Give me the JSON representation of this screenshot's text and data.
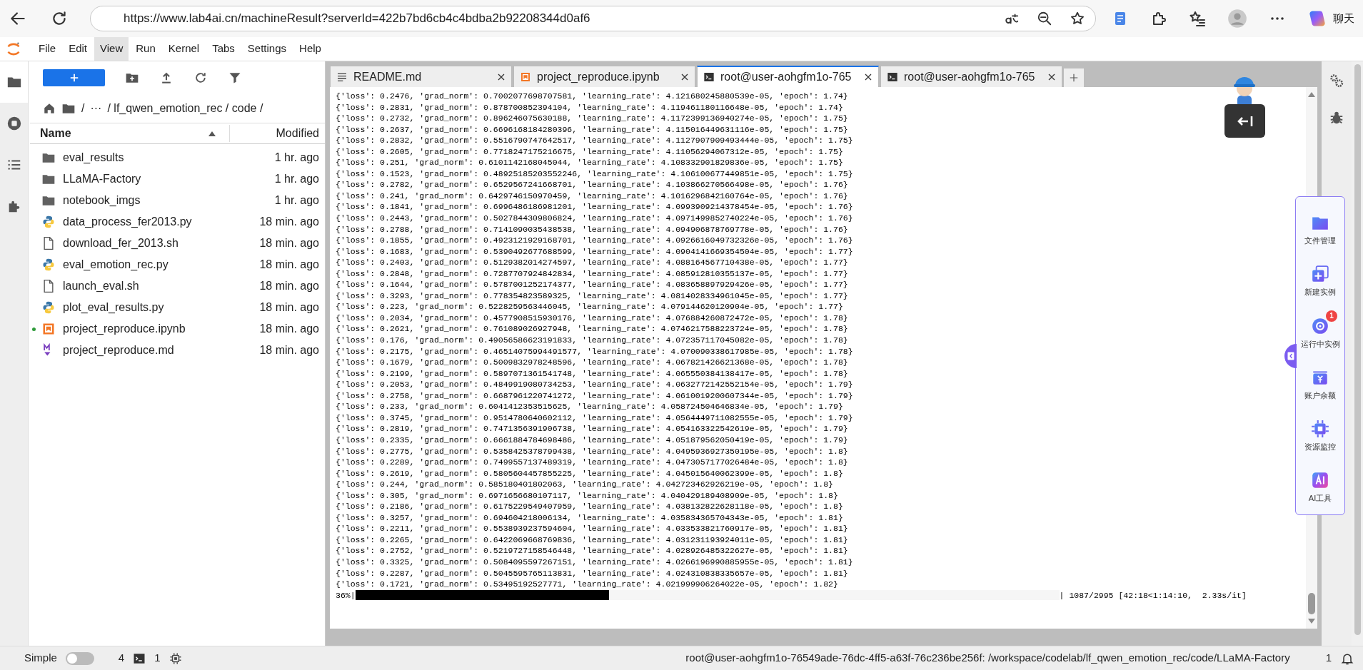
{
  "browser": {
    "url": "https://www.lab4ai.cn/machineResult?serverId=422b7bd6cb4c4bdba2b92208344d0af6",
    "chat_label": "聊天"
  },
  "menu": [
    {
      "label": "File",
      "selected": false
    },
    {
      "label": "Edit",
      "selected": false
    },
    {
      "label": "View",
      "selected": true
    },
    {
      "label": "Run",
      "selected": false
    },
    {
      "label": "Kernel",
      "selected": false
    },
    {
      "label": "Tabs",
      "selected": false
    },
    {
      "label": "Settings",
      "selected": false
    },
    {
      "label": "Help",
      "selected": false
    }
  ],
  "left_rail": [
    {
      "kind": "folder",
      "selected": true
    },
    {
      "kind": "running",
      "selected": false
    },
    {
      "kind": "toc",
      "selected": false
    },
    {
      "kind": "extensions",
      "selected": false
    }
  ],
  "file_browser": {
    "breadcrumb": [
      "/",
      "···",
      "/ lf_qwen_emotion_rec / code /"
    ],
    "columns": [
      "Name",
      "Modified"
    ],
    "files": [
      {
        "name": "eval_results",
        "modified": "1 hr. ago",
        "kind": "folder",
        "open": false
      },
      {
        "name": "LLaMA-Factory",
        "modified": "1 hr. ago",
        "kind": "folder",
        "open": false
      },
      {
        "name": "notebook_imgs",
        "modified": "1 hr. ago",
        "kind": "folder",
        "open": false
      },
      {
        "name": "data_process_fer2013.py",
        "modified": "18 min. ago",
        "kind": "python",
        "open": false
      },
      {
        "name": "download_fer_2013.sh",
        "modified": "18 min. ago",
        "kind": "file",
        "open": false
      },
      {
        "name": "eval_emotion_rec.py",
        "modified": "18 min. ago",
        "kind": "python",
        "open": false
      },
      {
        "name": "launch_eval.sh",
        "modified": "18 min. ago",
        "kind": "file",
        "open": false
      },
      {
        "name": "plot_eval_results.py",
        "modified": "18 min. ago",
        "kind": "python",
        "open": false
      },
      {
        "name": "project_reproduce.ipynb",
        "modified": "18 min. ago",
        "kind": "notebook",
        "open": true
      },
      {
        "name": "project_reproduce.md",
        "modified": "18 min. ago",
        "kind": "markdown",
        "open": false
      }
    ]
  },
  "tabs": [
    {
      "label": "README.md",
      "kind": "text",
      "selected": false
    },
    {
      "label": "project_reproduce.ipynb",
      "kind": "notebook",
      "selected": false
    },
    {
      "label": "root@user-aohgfm1o-765",
      "kind": "terminal",
      "selected": true
    },
    {
      "label": "root@user-aohgfm1o-765",
      "kind": "terminal",
      "selected": false
    }
  ],
  "terminal": {
    "lines": [
      "{'loss': 0.2476, 'grad_norm': 0.7002077698707581, 'learning_rate': 4.121680245880539e-05, 'epoch': 1.74}",
      "{'loss': 0.2831, 'grad_norm': 0.878700852394104, 'learning_rate': 4.119461180116648e-05, 'epoch': 1.74}",
      "{'loss': 0.2732, 'grad_norm': 0.896246075630188, 'learning_rate': 4.1172399136940274e-05, 'epoch': 1.75}",
      "{'loss': 0.2637, 'grad_norm': 0.6696168184280396, 'learning_rate': 4.115016449631116e-05, 'epoch': 1.75}",
      "{'loss': 0.2832, 'grad_norm': 0.5516790747642517, 'learning_rate': 4.1127907909493444e-05, 'epoch': 1.75}",
      "{'loss': 0.2605, 'grad_norm': 0.7718247175216675, 'learning_rate': 4.11056294067312e-05, 'epoch': 1.75}",
      "{'loss': 0.251, 'grad_norm': 0.6101142168045044, 'learning_rate': 4.108332901829836e-05, 'epoch': 1.75}",
      "{'loss': 0.1523, 'grad_norm': 0.48925185203552246, 'learning_rate': 4.106100677449851e-05, 'epoch': 1.75}",
      "{'loss': 0.2782, 'grad_norm': 0.6529567241668701, 'learning_rate': 4.103866270566498e-05, 'epoch': 1.76}",
      "{'loss': 0.241, 'grad_norm': 0.6429746150970459, 'learning_rate': 4.1016296842160764e-05, 'epoch': 1.76}",
      "{'loss': 0.1841, 'grad_norm': 0.6996486186981201, 'learning_rate': 4.0993909214378454e-05, 'epoch': 1.76}",
      "{'loss': 0.2443, 'grad_norm': 0.5027844309806824, 'learning_rate': 4.0971499852740224e-05, 'epoch': 1.76}",
      "{'loss': 0.2788, 'grad_norm': 0.7141090035438538, 'learning_rate': 4.094906878769778e-05, 'epoch': 1.76}",
      "{'loss': 0.1855, 'grad_norm': 0.4923121929168701, 'learning_rate': 4.0926616049732326e-05, 'epoch': 1.76}",
      "{'loss': 0.1683, 'grad_norm': 0.5390492677688599, 'learning_rate': 4.0904141669354504e-05, 'epoch': 1.77}",
      "{'loss': 0.2403, 'grad_norm': 0.5129382014274597, 'learning_rate': 4.088164567710438e-05, 'epoch': 1.77}",
      "{'loss': 0.2848, 'grad_norm': 0.7287707924842834, 'learning_rate': 4.085912810355137e-05, 'epoch': 1.77}",
      "{'loss': 0.1644, 'grad_norm': 0.5787001252174377, 'learning_rate': 4.083658897929426e-05, 'epoch': 1.77}",
      "{'loss': 0.3293, 'grad_norm': 0.778354823589325, 'learning_rate': 4.0814028334961045e-05, 'epoch': 1.77}",
      "{'loss': 0.223, 'grad_norm': 0.5228259563446045, 'learning_rate': 4.079144620120904e-05, 'epoch': 1.77}",
      "{'loss': 0.2034, 'grad_norm': 0.4577908515930176, 'learning_rate': 4.076884260872472e-05, 'epoch': 1.78}",
      "{'loss': 0.2621, 'grad_norm': 0.761089026927948, 'learning_rate': 4.0746217588223724e-05, 'epoch': 1.78}",
      "{'loss': 0.176, 'grad_norm': 0.49056586623191833, 'learning_rate': 4.072357117045082e-05, 'epoch': 1.78}",
      "{'loss': 0.2175, 'grad_norm': 0.46514075994491577, 'learning_rate': 4.070090338617985e-05, 'epoch': 1.78}",
      "{'loss': 0.1679, 'grad_norm': 0.5009832978248596, 'learning_rate': 4.067821426621368e-05, 'epoch': 1.78}",
      "{'loss': 0.2199, 'grad_norm': 0.5897071361541748, 'learning_rate': 4.065550384138417e-05, 'epoch': 1.78}",
      "{'loss': 0.2053, 'grad_norm': 0.4849919080734253, 'learning_rate': 4.0632772142552154e-05, 'epoch': 1.79}",
      "{'loss': 0.2758, 'grad_norm': 0.6687961220741272, 'learning_rate': 4.0610019200607344e-05, 'epoch': 1.79}",
      "{'loss': 0.233, 'grad_norm': 0.6041412353515625, 'learning_rate': 4.058724504646834e-05, 'epoch': 1.79}",
      "{'loss': 0.3745, 'grad_norm': 0.9514780640602112, 'learning_rate': 4.0564449711082555e-05, 'epoch': 1.79}",
      "{'loss': 0.2819, 'grad_norm': 0.7471356391906738, 'learning_rate': 4.054163322542619e-05, 'epoch': 1.79}",
      "{'loss': 0.2335, 'grad_norm': 0.6661884784698486, 'learning_rate': 4.051879562050419e-05, 'epoch': 1.79}",
      "{'loss': 0.2775, 'grad_norm': 0.5358425378799438, 'learning_rate': 4.0495936927350195e-05, 'epoch': 1.8}",
      "{'loss': 0.2289, 'grad_norm': 0.7499557137489319, 'learning_rate': 4.0473057177026484e-05, 'epoch': 1.8}",
      "{'loss': 0.2619, 'grad_norm': 0.5805604457855225, 'learning_rate': 4.045015640062399e-05, 'epoch': 1.8}",
      "{'loss': 0.244, 'grad_norm': 0.585180401802063, 'learning_rate': 4.042723462926219e-05, 'epoch': 1.8}",
      "{'loss': 0.305, 'grad_norm': 0.6971656680107117, 'learning_rate': 4.040429189408909e-05, 'epoch': 1.8}",
      "{'loss': 0.2186, 'grad_norm': 0.6175229549407959, 'learning_rate': 4.038132822628118e-05, 'epoch': 1.8}",
      "{'loss': 0.3257, 'grad_norm': 0.694604218006134, 'learning_rate': 4.035834365704343e-05, 'epoch': 1.81}",
      "{'loss': 0.2211, 'grad_norm': 0.5538939237594604, 'learning_rate': 4.033533821760917e-05, 'epoch': 1.81}",
      "{'loss': 0.2265, 'grad_norm': 0.6422069668769836, 'learning_rate': 4.031231193924011e-05, 'epoch': 1.81}",
      "{'loss': 0.2752, 'grad_norm': 0.5219727158546448, 'learning_rate': 4.028926485322627e-05, 'epoch': 1.81}",
      "{'loss': 0.3325, 'grad_norm': 0.5084095597267151, 'learning_rate': 4.0266196990885955e-05, 'epoch': 1.81}",
      "{'loss': 0.2287, 'grad_norm': 0.5045595765113831, 'learning_rate': 4.024310838335657e-05, 'epoch': 1.81}",
      "{'loss': 0.1721, 'grad_norm': 0.53495192527771, 'learning_rate': 4.021999906264022e-05, 'epoch': 1.82}"
    ],
    "progress": {
      "percent": "36%|",
      "level": 0.36,
      "stats": "| 1087/2995 [42:18<1:14:10,  2.33s/it]"
    }
  },
  "right_rail": [
    {
      "kind": "property-inspector"
    },
    {
      "kind": "debugger"
    }
  ],
  "side_panel": [
    {
      "label": "文件管理",
      "kind": "folder"
    },
    {
      "label": "新建实例",
      "kind": "new"
    },
    {
      "label": "运行中实例",
      "kind": "running",
      "badge": "1"
    },
    {
      "label": "账户余额",
      "kind": "wallet"
    },
    {
      "label": "资源监控",
      "kind": "chip"
    },
    {
      "label": "AI工具",
      "kind": "ai"
    }
  ],
  "status_bar": {
    "mode_label": "Simple",
    "simple_mode": false,
    "kernels": "4",
    "terminals": "1",
    "path": "root@user-aohgfm1o-76549ade-76dc-4ff5-a63f-76c236be256f: /workspace/codelab/lf_qwen_emotion_rec/code/LLaMA-Factory",
    "notifications": "1"
  }
}
